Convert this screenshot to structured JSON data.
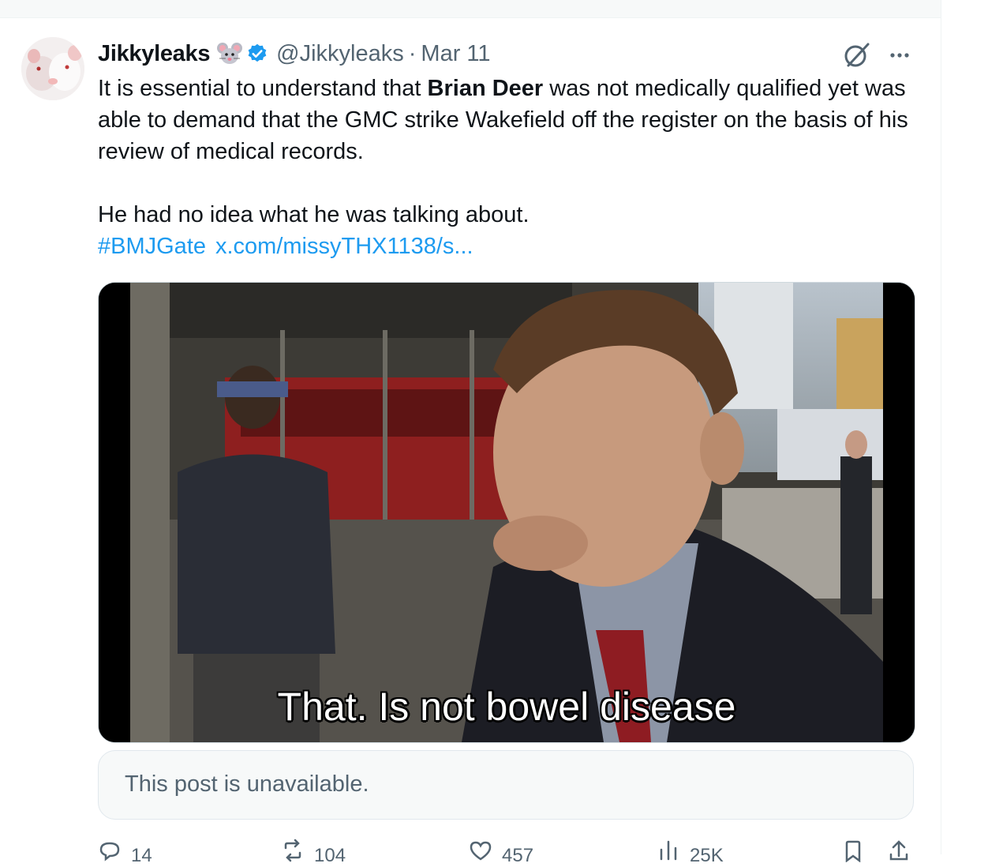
{
  "tweet": {
    "display_name": "Jikkyleaks",
    "handle": "@Jikkyleaks",
    "separator": "·",
    "date": "Mar 11",
    "text_part1": "It is essential to understand that ",
    "text_bold": "Brian Deer",
    "text_part2": " was not medically qualified yet was able to demand that the GMC strike Wakefield off the register on the basis of his review of medical records.",
    "text_paragraph2": "He had no idea what he was talking about.",
    "hashtag": "#BMJGate",
    "link": "x.com/missyTHX1138/s...",
    "video_subtitle": "That. Is not bowel disease",
    "quoted_unavailable": "This post is unavailable."
  },
  "actions": {
    "reply_count": "14",
    "repost_count": "104",
    "like_count": "457",
    "views_count": "25K"
  },
  "icons": {
    "emoji": "mouse-emoji-icon",
    "verified": "verified-badge-icon",
    "grok": "grok-icon",
    "more": "more-icon",
    "reply": "reply-icon",
    "repost": "repost-icon",
    "like": "heart-icon",
    "views": "views-icon",
    "bookmark": "bookmark-icon",
    "share": "share-icon"
  },
  "colors": {
    "link": "#1d9bf0",
    "verified": "#1d9bf0",
    "secondary_text": "#536471"
  }
}
